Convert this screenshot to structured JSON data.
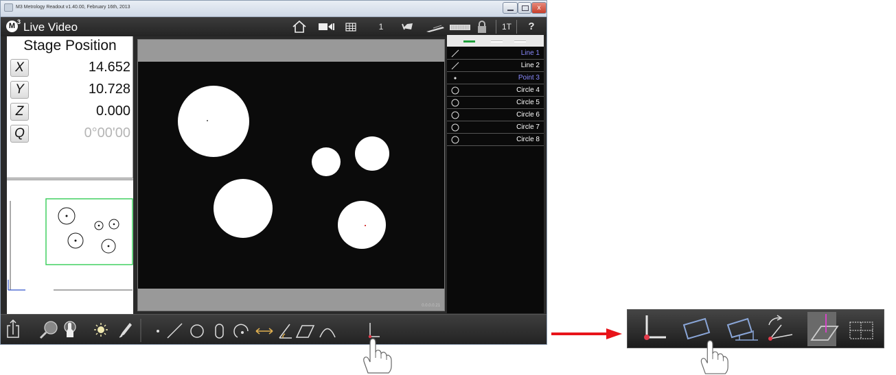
{
  "window": {
    "title": "M3 Metrology Readout  v1.40.00, February 16th, 2013",
    "close_glyph": "x"
  },
  "app": {
    "logo_letter": "M",
    "logo_sup": "3",
    "view_title": "Live Video",
    "toolbar": {
      "icons": [
        "home-icon",
        "video-camera-icon",
        "grid-table-icon",
        "part-count-icon",
        "undo-icon",
        "erase-icon",
        "keyboard-icon",
        "lock-icon",
        "tool-count-icon",
        "help-icon"
      ],
      "part_count": "1",
      "tool_count": "1T",
      "help_label": "?"
    }
  },
  "stage": {
    "header": "Stage Position",
    "axes": [
      {
        "label": "X",
        "value": "14.652",
        "dim": false
      },
      {
        "label": "Y",
        "value": "10.728",
        "dim": false
      },
      {
        "label": "Z",
        "value": "0.000",
        "dim": false
      },
      {
        "label": "Q",
        "value": "0°00'00",
        "dim": true
      }
    ]
  },
  "features": {
    "items": [
      {
        "name": "Line 1",
        "type": "line",
        "selected": true
      },
      {
        "name": "Line 2",
        "type": "line",
        "selected": false
      },
      {
        "name": "Point 3",
        "type": "point",
        "selected": true
      },
      {
        "name": "Circle 4",
        "type": "circle",
        "selected": false
      },
      {
        "name": "Circle 5",
        "type": "circle",
        "selected": false
      },
      {
        "name": "Circle 6",
        "type": "circle",
        "selected": false
      },
      {
        "name": "Circle 7",
        "type": "circle",
        "selected": false
      },
      {
        "name": "Circle 8",
        "type": "circle",
        "selected": false
      }
    ],
    "header_colors": [
      "#1e9e3a",
      "#ffffff",
      "#ffffff"
    ]
  },
  "bottom_toolbar": {
    "left_tools": [
      "export-icon",
      "zoom-icon",
      "touch-probe-icon",
      "light-icon",
      "pen-icon"
    ],
    "measure_tools": [
      "point-tool-icon",
      "line-tool-icon",
      "circle-tool-icon",
      "slot-tool-icon",
      "arc-tool-icon",
      "distance-tool-icon",
      "angle-tool-icon",
      "parallelogram-tool-icon",
      "curve-tool-icon",
      "datum-tool-icon"
    ]
  },
  "expanded_toolbar": {
    "tools": [
      "datum-origin-icon",
      "skew-plane-icon",
      "level-plane-icon",
      "rotate-axis-icon",
      "reference-plane-icon",
      "grid-pattern-icon"
    ]
  },
  "video": {
    "frame_counter": "0.0.0.0.21"
  },
  "colors": {
    "accent_selected": "#8a8aff",
    "minimap_frame": "#33cc55",
    "arrow": "#e8141a",
    "datum_marker": "#e23a4a"
  }
}
